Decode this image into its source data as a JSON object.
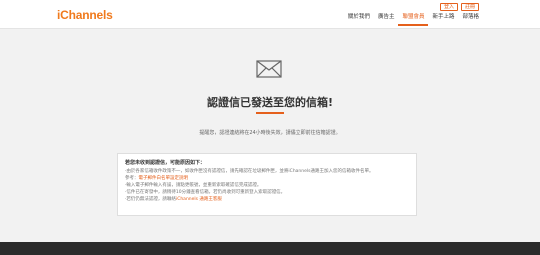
{
  "header": {
    "logo": "iChannels",
    "auth": {
      "login": "登入",
      "register": "註冊"
    },
    "nav": [
      {
        "label": "關於我們"
      },
      {
        "label": "廣告主"
      },
      {
        "label": "聯盟會員",
        "active": true
      },
      {
        "label": "新手上路"
      },
      {
        "label": "部落格"
      }
    ]
  },
  "main": {
    "icon": "envelope-icon",
    "heading": "認證信已發送至您的信箱!",
    "intro": "提醒您，認證連結將在24小時後失效，請儘立即前往信箱認證。"
  },
  "notice": {
    "title": "若您未收到認證信，可能原因如下：",
    "lines": [
      {
        "text": "‧由於各家信箱收件政策不一，如收件匣沒有認證信，請先確認在垃圾郵件匣，並將iChannels通路王加入您的信箱收件名單。"
      },
      {
        "prefix": "參考：",
        "link": "電子郵件白名單設定說明"
      },
      {
        "text": "‧輸入電子郵件輸入有誤，請點更帳號，並重新索取確認信完成認證。"
      },
      {
        "text": "‧信件已在寄發中，請稍待10分鐘查看信箱，若仍尚收到可重新登入索取認證信。"
      },
      {
        "prefix": "‧若仍仍無法認證，請聯絡",
        "link": "iChannels 通路王客服"
      }
    ]
  },
  "colors": {
    "accent": "#e5601c",
    "logo": "#f07a1d",
    "footer": "#2b2b2b"
  }
}
